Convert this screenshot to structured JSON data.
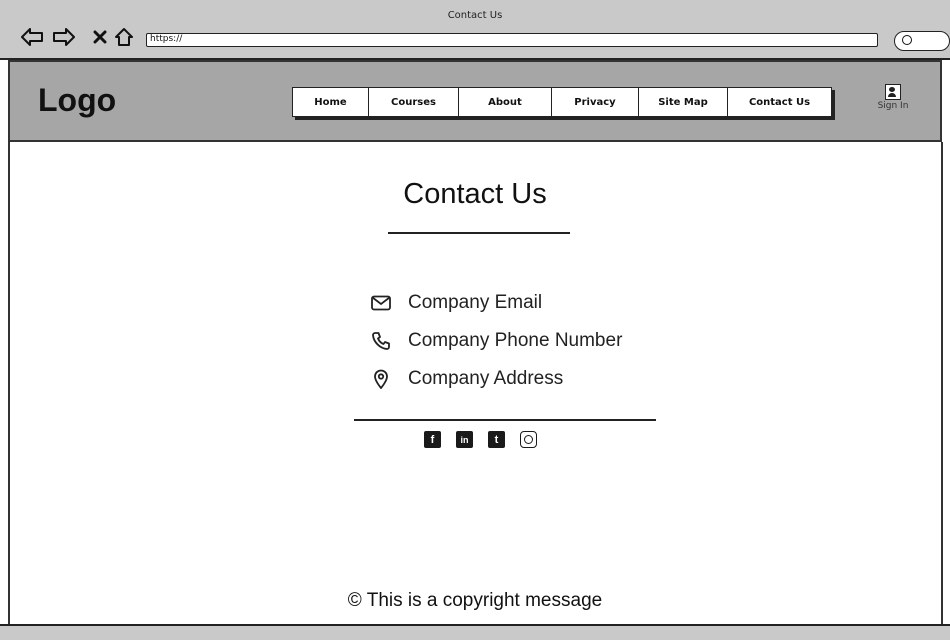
{
  "browser": {
    "window_title": "Contact Us",
    "url": "https://",
    "nav_icons": [
      "back-arrow",
      "forward-arrow",
      "close",
      "home"
    ]
  },
  "header": {
    "logo": "Logo",
    "menu": [
      "Home",
      "Courses",
      "About",
      "Privacy",
      "Site Map",
      "Contact Us"
    ],
    "sign_in": "Sign In"
  },
  "main": {
    "title": "Contact Us",
    "contacts": [
      {
        "icon": "envelope-icon",
        "text": "Company Email"
      },
      {
        "icon": "phone-icon",
        "text": "Company Phone Number"
      },
      {
        "icon": "location-pin-icon",
        "text": "Company Address"
      }
    ],
    "social": [
      {
        "icon": "facebook-icon",
        "glyph": "f"
      },
      {
        "icon": "linkedin-icon",
        "glyph": "in"
      },
      {
        "icon": "twitter-icon",
        "glyph": "t"
      },
      {
        "icon": "instagram-icon",
        "glyph": ""
      }
    ]
  },
  "footer": {
    "copyright": "© This is a copyright message"
  },
  "colors": {
    "chrome_bg": "#c9c9c9",
    "header_bg": "#a6a6a6",
    "ink": "#111111"
  }
}
